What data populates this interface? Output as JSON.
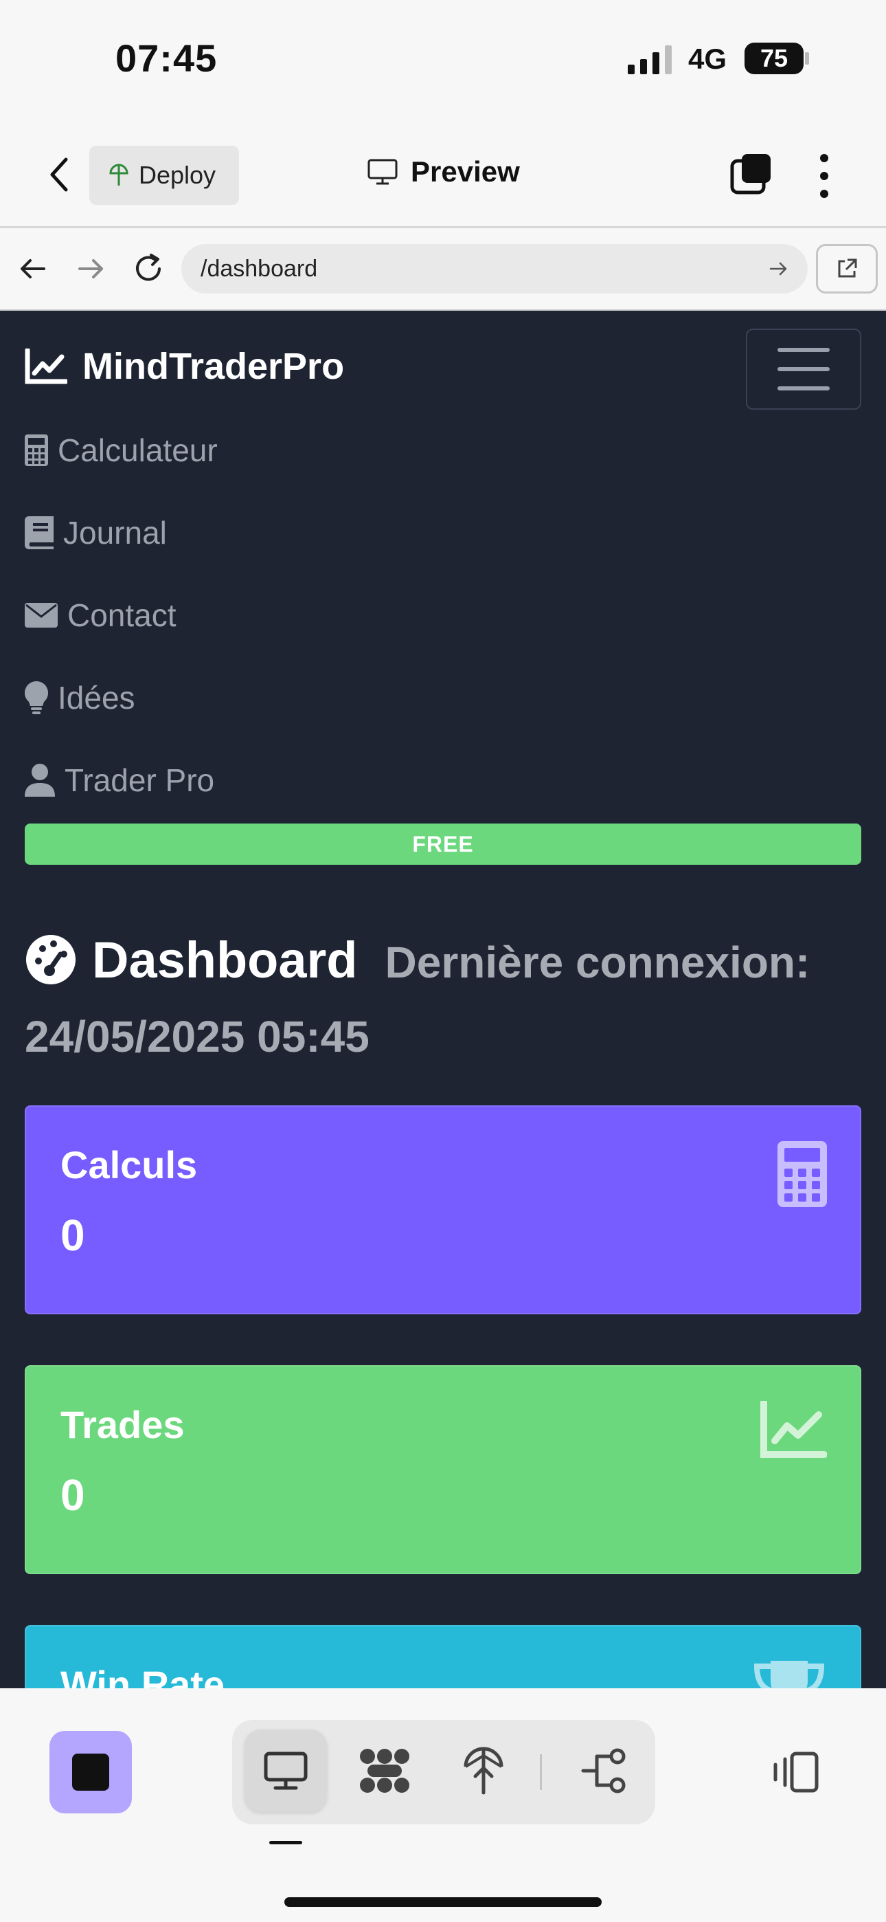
{
  "status_bar": {
    "time": "07:45",
    "network": "4G",
    "battery": "75"
  },
  "app_bar": {
    "deploy_label": "Deploy",
    "title": "Preview"
  },
  "browser": {
    "url": "/dashboard"
  },
  "site": {
    "brand": "MindTraderPro",
    "menu": [
      {
        "label": "Calculateur",
        "icon": "calculator-icon"
      },
      {
        "label": "Journal",
        "icon": "book-icon"
      },
      {
        "label": "Contact",
        "icon": "envelope-icon"
      },
      {
        "label": "Idées",
        "icon": "lightbulb-icon"
      },
      {
        "label": "Trader Pro",
        "icon": "user-icon"
      }
    ],
    "plan_badge": "FREE"
  },
  "dashboard": {
    "title": "Dashboard",
    "last_login_label": "Dernière connexion:",
    "last_login": "24/05/2025 05:45",
    "stats": [
      {
        "label": "Calculs",
        "value": "0",
        "color": "#775cff",
        "icon": "calculator-icon"
      },
      {
        "label": "Trades",
        "value": "0",
        "color": "#6cd87d",
        "icon": "chart-line-icon"
      },
      {
        "label": "Win Rate",
        "value": "",
        "color": "#27b9d8",
        "icon": "trophy-icon"
      }
    ]
  },
  "colors": {
    "page_bg": "#1f2433",
    "accent_purple": "#775cff",
    "success_green": "#6cd87d",
    "info_cyan": "#27b9d8",
    "stop_button": "#b4a6ff"
  }
}
